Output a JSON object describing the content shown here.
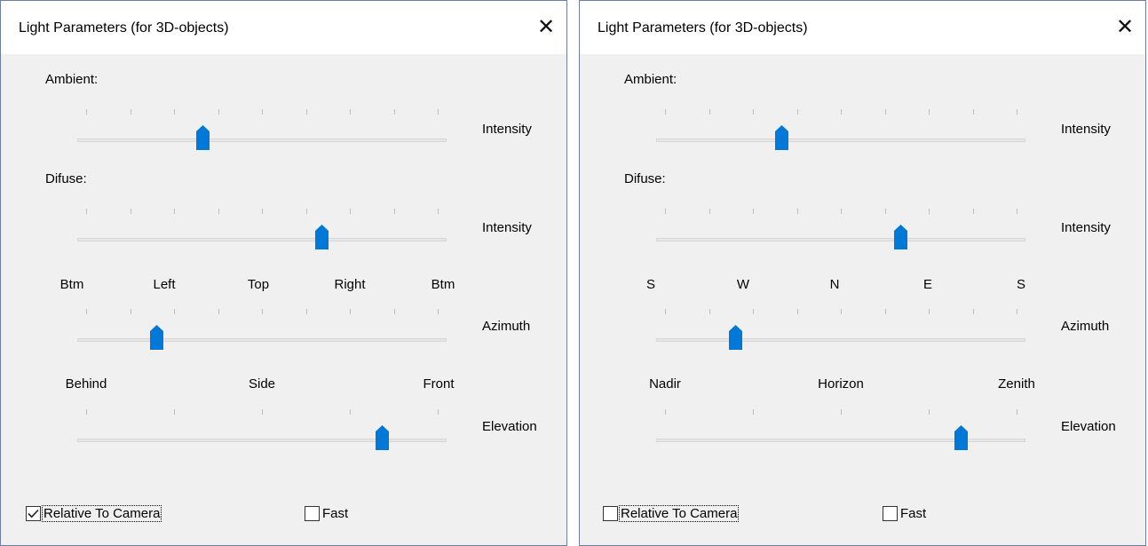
{
  "dialogs": [
    {
      "title": "Light Parameters (for 3D-objects)",
      "close_glyph": "✕",
      "ambient_label": "Ambient:",
      "diffuse_label": "Difuse:",
      "ambient_intensity": {
        "side_label": "Intensity",
        "value": 0.33
      },
      "diffuse_intensity": {
        "side_label": "Intensity",
        "value": 0.67
      },
      "azimuth": {
        "side_label": "Azimuth",
        "value": 0.2,
        "scale": [
          "Btm",
          "Left",
          "Top",
          "Right",
          "Btm"
        ]
      },
      "elevation": {
        "side_label": "Elevation",
        "value": 0.84,
        "scale": [
          "Behind",
          "Side",
          "Front"
        ]
      },
      "relative_to_camera": {
        "label": "Relative To Camera",
        "checked": true
      },
      "fast": {
        "label": "Fast",
        "checked": false
      }
    },
    {
      "title": "Light Parameters (for 3D-objects)",
      "close_glyph": "✕",
      "ambient_label": "Ambient:",
      "diffuse_label": "Difuse:",
      "ambient_intensity": {
        "side_label": "Intensity",
        "value": 0.33
      },
      "diffuse_intensity": {
        "side_label": "Intensity",
        "value": 0.67
      },
      "azimuth": {
        "side_label": "Azimuth",
        "value": 0.2,
        "scale": [
          "S",
          "W",
          "N",
          "E",
          "S"
        ]
      },
      "elevation": {
        "side_label": "Elevation",
        "value": 0.84,
        "scale": [
          "Nadir",
          "Horizon",
          "Zenith"
        ]
      },
      "relative_to_camera": {
        "label": "Relative To Camera",
        "checked": false
      },
      "fast": {
        "label": "Fast",
        "checked": false
      }
    }
  ],
  "colors": {
    "accent": "#0078d7",
    "dialog_bg": "#f0f0f0",
    "border": "#6d7da8"
  },
  "icons": {
    "close": "close-icon",
    "checkmark": "checkmark-icon",
    "slider_thumb": "slider-thumb"
  }
}
